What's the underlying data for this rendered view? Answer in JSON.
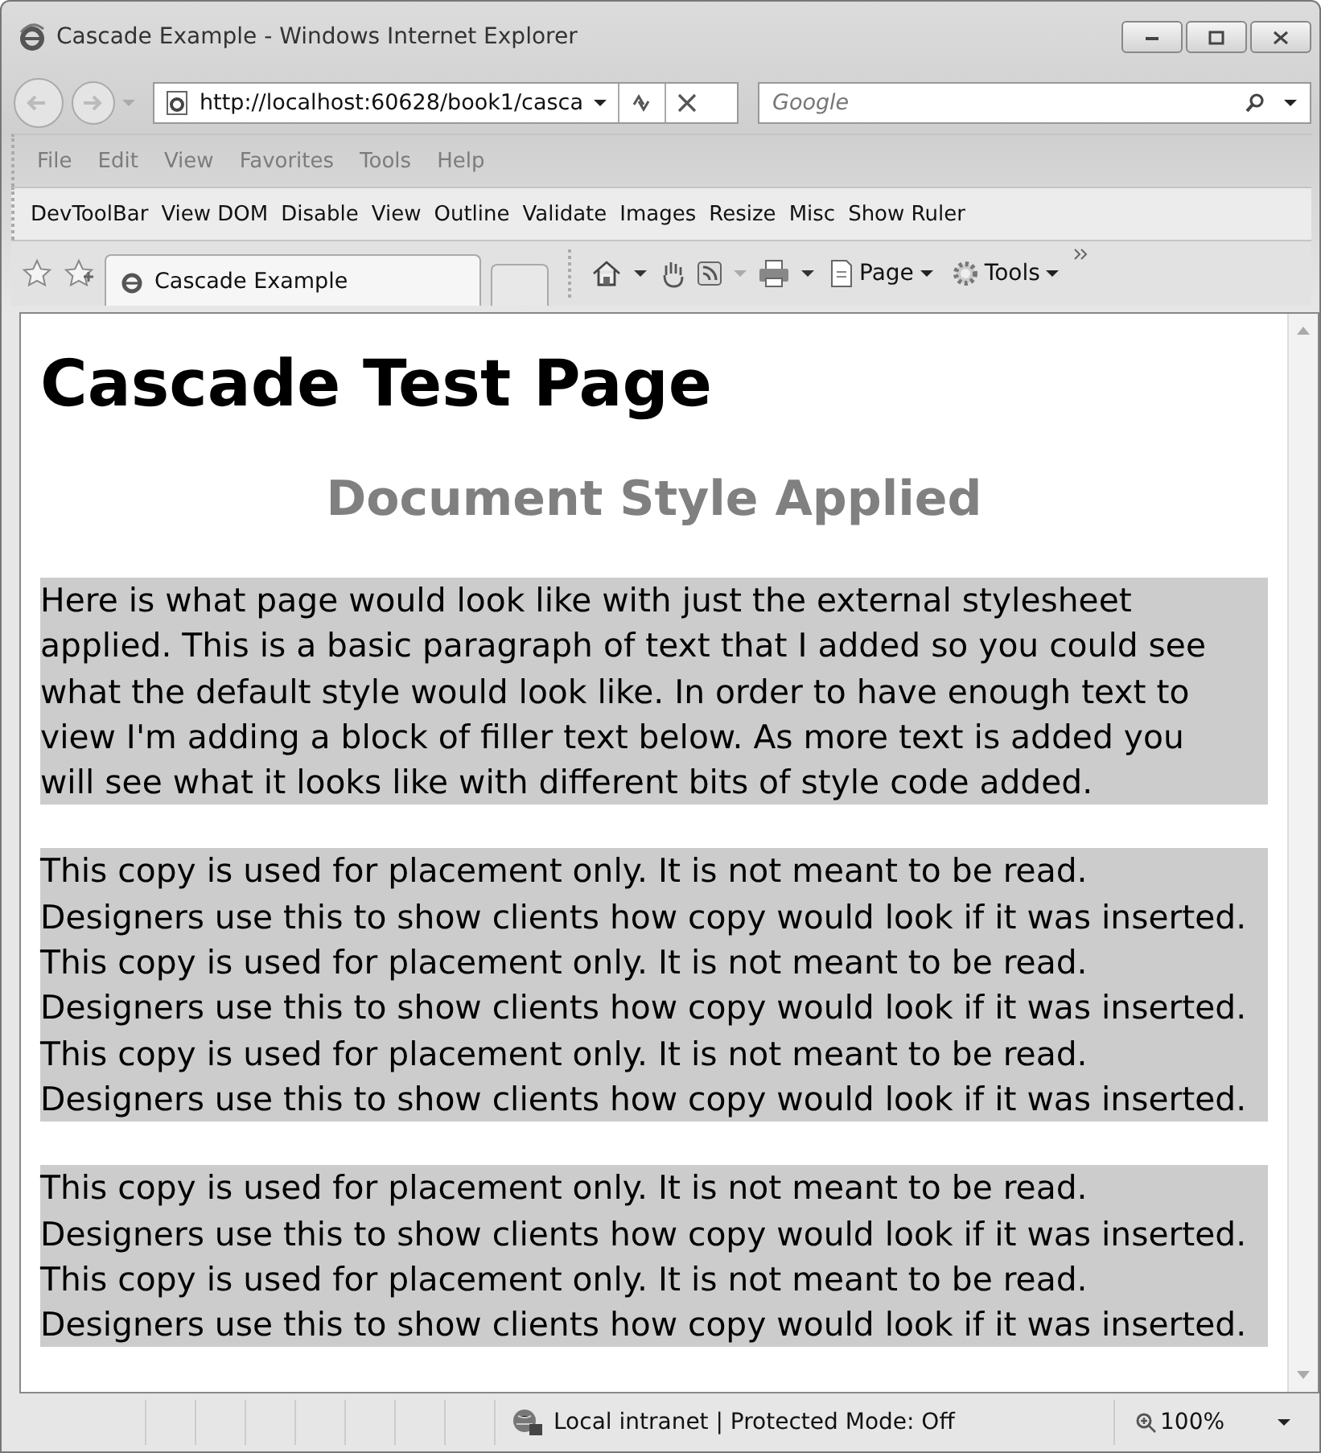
{
  "window": {
    "title": "Cascade Example - Windows Internet Explorer"
  },
  "address_bar": {
    "value": "http://localhost:60628/book1/casca"
  },
  "search": {
    "placeholder": "Google"
  },
  "menu_bar": {
    "disabled": true,
    "items": [
      "File",
      "Edit",
      "View",
      "Favorites",
      "Tools",
      "Help"
    ]
  },
  "dev_toolbar": {
    "items": [
      "DevToolBar",
      "View DOM",
      "Disable",
      "View",
      "Outline",
      "Validate",
      "Images",
      "Resize",
      "Misc",
      "Show Ruler"
    ]
  },
  "tabs": [
    {
      "label": "Cascade Example",
      "selected": true
    }
  ],
  "command_bar": {
    "items": [
      "Page",
      "Tools"
    ]
  },
  "page": {
    "heading": "Cascade Test Page",
    "subheading": "Document Style Applied",
    "paragraphs": [
      [
        "Here is what page would look like with just the external stylesheet",
        "applied. This is a basic paragraph of text that I added  so you could see",
        "what the default style would look like. In order to have enough text to",
        "view I'm adding a block of filler text below. As more text is added you",
        "will see what it looks like with different bits of style code added."
      ],
      [
        "This copy is used for placement only. It is not meant to be read.",
        "Designers use this to show clients how copy would look if it was inserted.",
        "This copy is used for placement only. It is not meant to be read.",
        "Designers use this to show clients how copy would look if it was inserted.",
        "This copy is used for placement only. It is not meant to be read.",
        "Designers use this to show clients how copy would look if it was inserted."
      ],
      [
        "This copy is used for placement only. It is not meant to be read.",
        "Designers use this to show clients how copy would look if it was inserted.",
        "This copy is used for placement only. It is not meant to be read.",
        "Designers use this to show clients how copy would look if it was inserted."
      ]
    ]
  },
  "status_bar": {
    "zone": "Local intranet | Protected Mode: Off",
    "zoom": "100%"
  }
}
